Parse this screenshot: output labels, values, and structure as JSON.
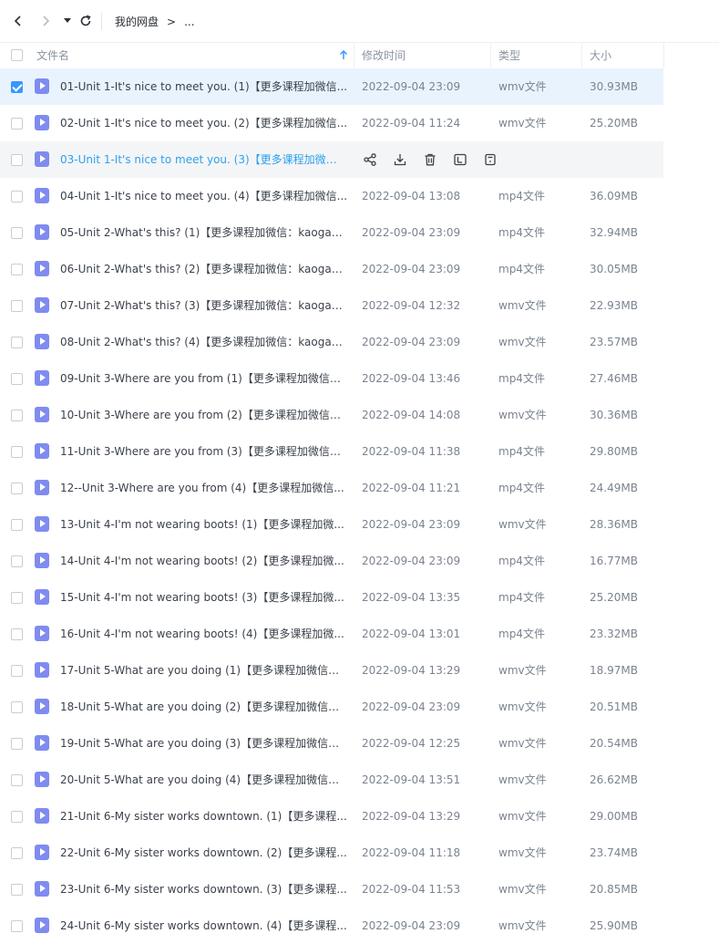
{
  "toolbar": {
    "breadcrumb_root": "我的网盘",
    "breadcrumb_sep": ">",
    "breadcrumb_more": "..."
  },
  "header": {
    "name": "文件名",
    "modified": "修改时间",
    "type": "类型",
    "size": "大小"
  },
  "colors": {
    "accent": "#3a96ff",
    "link": "#2ea0ee",
    "video_icon": "#7f8bf0"
  },
  "files": [
    {
      "name": "01-Unit 1-It's nice to meet you. (1)【更多课程加微信...",
      "date": "2022-09-04 23:09",
      "type": "wmv文件",
      "size": "30.93MB",
      "state": "selected"
    },
    {
      "name": "02-Unit 1-It's nice to meet you. (2)【更多课程加微信...",
      "date": "2022-09-04 11:24",
      "type": "wmv文件",
      "size": "25.20MB",
      "state": ""
    },
    {
      "name": "03-Unit 1-It's nice to meet you. (3)【更多课程加微信...",
      "date": "",
      "type": "",
      "size": "",
      "state": "hover"
    },
    {
      "name": "04-Unit 1-It's nice to meet you. (4)【更多课程加微信...",
      "date": "2022-09-04 13:08",
      "type": "mp4文件",
      "size": "36.09MB",
      "state": ""
    },
    {
      "name": "05-Unit 2-What's this? (1)【更多课程加微信：kaogao...",
      "date": "2022-09-04 23:09",
      "type": "mp4文件",
      "size": "32.94MB",
      "state": ""
    },
    {
      "name": "06-Unit 2-What's this? (2)【更多课程加微信：kaogao...",
      "date": "2022-09-04 23:09",
      "type": "mp4文件",
      "size": "30.05MB",
      "state": ""
    },
    {
      "name": "07-Unit 2-What's this? (3)【更多课程加微信：kaogao...",
      "date": "2022-09-04 12:32",
      "type": "wmv文件",
      "size": "22.93MB",
      "state": ""
    },
    {
      "name": "08-Unit 2-What's this? (4)【更多课程加微信：kaogao...",
      "date": "2022-09-04 23:09",
      "type": "wmv文件",
      "size": "23.57MB",
      "state": ""
    },
    {
      "name": "09-Unit 3-Where are you from (1)【更多课程加微信：...",
      "date": "2022-09-04 13:46",
      "type": "mp4文件",
      "size": "27.46MB",
      "state": ""
    },
    {
      "name": "10-Unit 3-Where are you from (2)【更多课程加微信：...",
      "date": "2022-09-04 14:08",
      "type": "wmv文件",
      "size": "30.36MB",
      "state": ""
    },
    {
      "name": "11-Unit 3-Where are you from (3)【更多课程加微信：...",
      "date": "2022-09-04 11:38",
      "type": "mp4文件",
      "size": "29.80MB",
      "state": ""
    },
    {
      "name": "12--Unit 3-Where are you from (4)【更多课程加微信...",
      "date": "2022-09-04 11:21",
      "type": "mp4文件",
      "size": "24.49MB",
      "state": ""
    },
    {
      "name": "13-Unit 4-I'm not wearing boots! (1)【更多课程加微...",
      "date": "2022-09-04 23:09",
      "type": "wmv文件",
      "size": "28.36MB",
      "state": ""
    },
    {
      "name": "14-Unit 4-I'm not wearing boots! (2)【更多课程加微...",
      "date": "2022-09-04 23:09",
      "type": "mp4文件",
      "size": "16.77MB",
      "state": ""
    },
    {
      "name": "15-Unit 4-I'm not wearing boots! (3)【更多课程加微...",
      "date": "2022-09-04 13:35",
      "type": "mp4文件",
      "size": "25.20MB",
      "state": ""
    },
    {
      "name": "16-Unit 4-I'm not wearing boots! (4)【更多课程加微...",
      "date": "2022-09-04 13:01",
      "type": "mp4文件",
      "size": "23.32MB",
      "state": ""
    },
    {
      "name": "17-Unit 5-What are you doing (1)【更多课程加微信：...",
      "date": "2022-09-04 13:29",
      "type": "wmv文件",
      "size": "18.97MB",
      "state": ""
    },
    {
      "name": "18-Unit 5-What are you doing (2)【更多课程加微信：...",
      "date": "2022-09-04 23:09",
      "type": "wmv文件",
      "size": "20.51MB",
      "state": ""
    },
    {
      "name": "19-Unit 5-What are you doing (3)【更多课程加微信：...",
      "date": "2022-09-04 12:25",
      "type": "wmv文件",
      "size": "20.54MB",
      "state": ""
    },
    {
      "name": "20-Unit 5-What are you doing (4)【更多课程加微信：...",
      "date": "2022-09-04 13:51",
      "type": "wmv文件",
      "size": "26.62MB",
      "state": ""
    },
    {
      "name": "21-Unit 6-My sister works downtown. (1)【更多课程...",
      "date": "2022-09-04 13:29",
      "type": "wmv文件",
      "size": "29.00MB",
      "state": ""
    },
    {
      "name": "22-Unit 6-My sister works downtown. (2)【更多课程...",
      "date": "2022-09-04 11:18",
      "type": "wmv文件",
      "size": "23.74MB",
      "state": ""
    },
    {
      "name": "23-Unit 6-My sister works downtown. (3)【更多课程...",
      "date": "2022-09-04 11:53",
      "type": "wmv文件",
      "size": "20.85MB",
      "state": ""
    },
    {
      "name": "24-Unit 6-My sister works downtown. (4)【更多课程...",
      "date": "2022-09-04 23:09",
      "type": "wmv文件",
      "size": "25.90MB",
      "state": ""
    }
  ],
  "hover_actions": [
    "share-icon",
    "download-icon",
    "delete-icon",
    "rename-icon",
    "more-icon"
  ]
}
